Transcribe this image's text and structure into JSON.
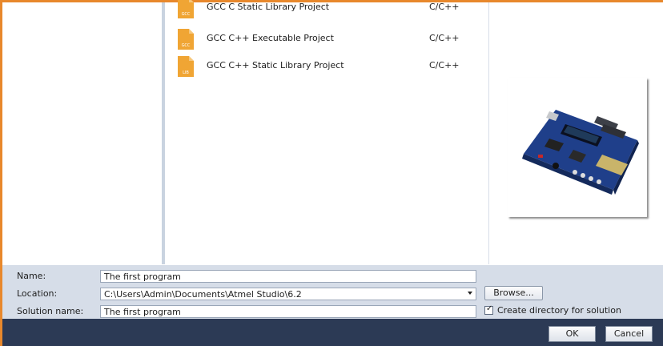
{
  "templates": [
    {
      "name": "GCC C Static Library Project",
      "language": "C/C++",
      "icon": "file-icon",
      "badge": "GCC"
    },
    {
      "name": "GCC C++ Executable Project",
      "language": "C/C++",
      "icon": "file-icon",
      "badge": "GCC"
    },
    {
      "name": "GCC C++ Static Library Project",
      "language": "C/C++",
      "icon": "file-icon",
      "badge": "LIB"
    }
  ],
  "form": {
    "name_label": "Name:",
    "name_value": "The first program",
    "location_label": "Location:",
    "location_value": "C:\\Users\\Admin\\Documents\\Atmel Studio\\6.2",
    "solution_label": "Solution name:",
    "solution_value": "The first program",
    "browse_label": "Browse...",
    "create_dir_label": "Create directory for solution",
    "create_dir_checked": true
  },
  "buttons": {
    "ok": "OK",
    "cancel": "Cancel"
  },
  "colors": {
    "accent": "#e8882c",
    "icon_orange": "#f0a534",
    "panel": "#d6dde8",
    "bottom_bar": "#2c3a55"
  }
}
